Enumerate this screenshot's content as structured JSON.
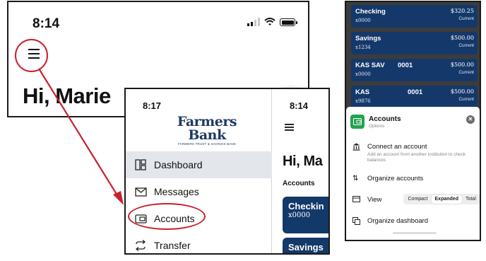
{
  "panel1": {
    "time": "8:14",
    "greeting": "Hi, Marie"
  },
  "panel2": {
    "time_drawer": "8:17",
    "time_main": "8:14",
    "logo": {
      "line1": "Farmers",
      "line2": "Bank",
      "line3": "FARMERS TRUST & SAVINGS BANK"
    },
    "menu": [
      {
        "label": "Dashboard",
        "icon": "dashboard-icon",
        "active": true
      },
      {
        "label": "Messages",
        "icon": "envelope-icon",
        "active": false
      },
      {
        "label": "Accounts",
        "icon": "wallet-icon",
        "active": false
      },
      {
        "label": "Transfer",
        "icon": "transfer-icon",
        "active": false
      }
    ],
    "greeting": "Hi, Ma",
    "accounts_heading": "Accounts",
    "accounts": [
      {
        "name": "Checkin",
        "mask": "x0000"
      },
      {
        "name": "Savings",
        "mask": ""
      }
    ]
  },
  "panel3": {
    "accounts": [
      {
        "name": "Checking",
        "number": "",
        "mask": "x0000",
        "balance": "$320.25",
        "status": "Current"
      },
      {
        "name": "Savings",
        "number": "",
        "mask": "x1234",
        "balance": "$500.00",
        "status": "Current"
      },
      {
        "name": "KAS SAV",
        "number": "0001",
        "mask": "x0000",
        "balance": "$500.00",
        "status": "Current"
      },
      {
        "name": "KAS",
        "number": "0001",
        "mask": "x9876",
        "balance": "$500.00",
        "status": "Current"
      }
    ],
    "sheet": {
      "title": "Accounts",
      "subtitle": "Options",
      "connect_title": "Connect an account",
      "connect_desc": "Add an account from another institution to check balances",
      "organize_accounts": "Organize accounts",
      "view_label": "View",
      "view_options": [
        "Compact",
        "Expanded",
        "Total"
      ],
      "view_selected": "Expanded",
      "organize_dashboard": "Organize dashboard"
    }
  },
  "colors": {
    "navy": "#13386a",
    "annotation_red": "#c8202c",
    "accent_green": "#23a24f"
  }
}
